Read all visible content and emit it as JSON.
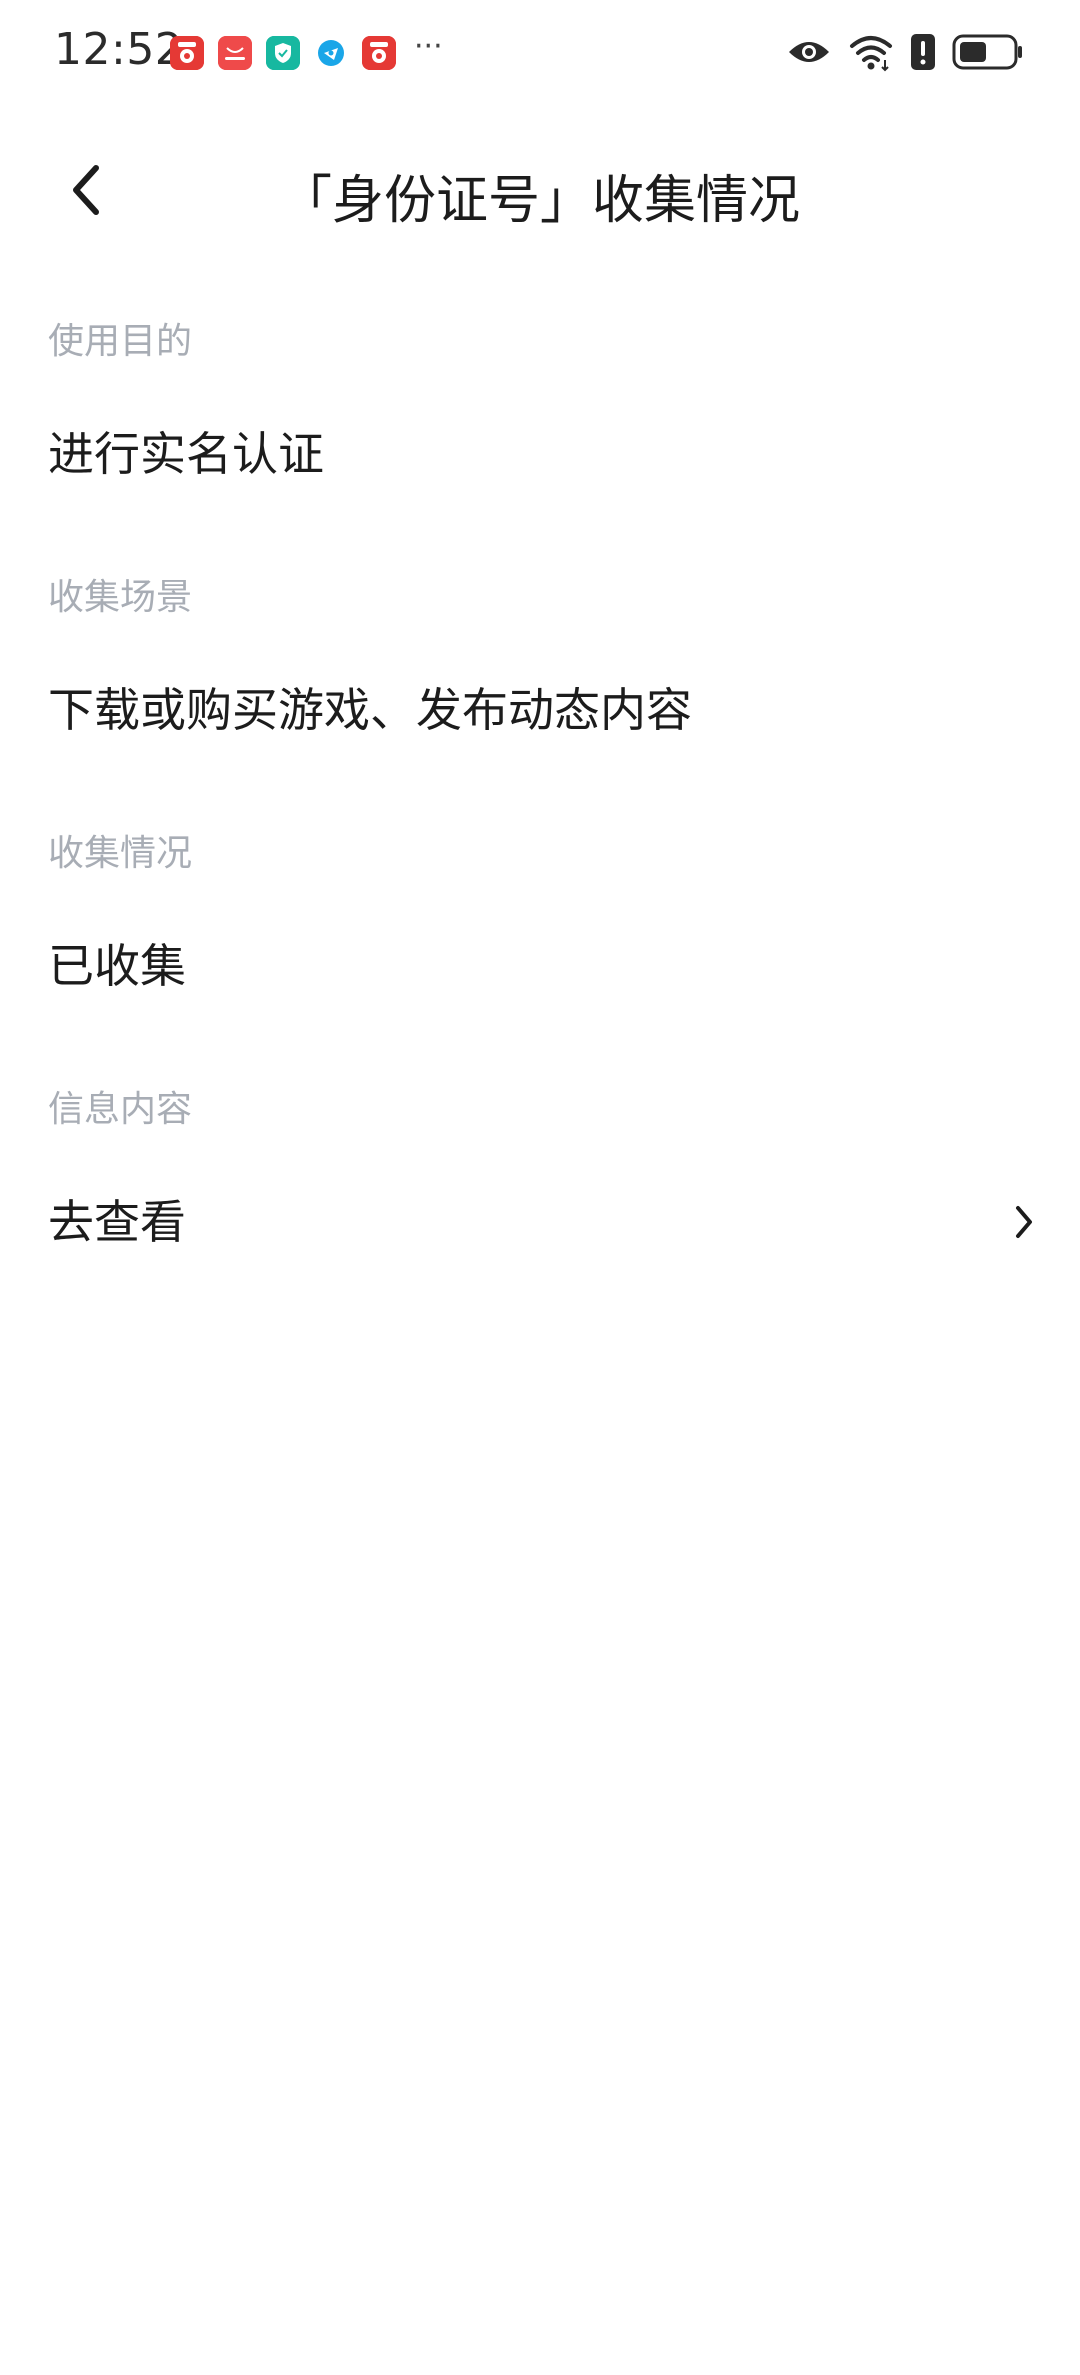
{
  "status_bar": {
    "time": "12:52",
    "notification_icons": [
      "video-app-icon",
      "huawei-store-icon",
      "security-shield-icon",
      "browser-icon",
      "video-app-icon"
    ],
    "more_indicator": "···",
    "system_icons": [
      "eye-comfort-icon",
      "wifi-icon",
      "alert-icon",
      "battery-icon"
    ]
  },
  "header": {
    "title": "「身份证号」收集情况",
    "back_icon": "chevron-left-icon"
  },
  "sections": [
    {
      "label": "使用目的",
      "value": "进行实名认证"
    },
    {
      "label": "收集场景",
      "value": "下载或购买游戏、发布动态内容"
    },
    {
      "label": "收集情况",
      "value": "已收集"
    },
    {
      "label": "信息内容",
      "value": "去查看",
      "action_icon": "chevron-right-icon"
    }
  ],
  "colors": {
    "label_gray": "#a8adb5",
    "text_dark": "#1c1c1c",
    "background": "#ffffff"
  }
}
